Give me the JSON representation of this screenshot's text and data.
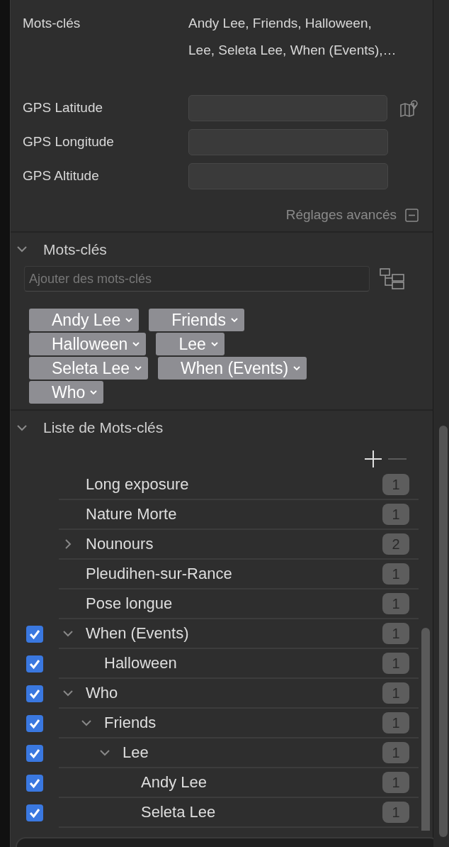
{
  "metadata": {
    "rows": [
      {
        "kind": "text",
        "label": "Mots-clés",
        "value_lines": [
          "Andy Lee, Friends, Halloween,",
          "Lee, Seleta Lee, When (Events),…"
        ]
      },
      {
        "kind": "field",
        "label": "GPS Latitude",
        "map_button": true
      },
      {
        "kind": "field",
        "label": "GPS Longitude"
      },
      {
        "kind": "field",
        "label": "GPS Altitude"
      }
    ],
    "advanced": {
      "label": "Réglages avancés",
      "expanded": true
    }
  },
  "keywords": {
    "title": "Mots-clés",
    "expanded": true,
    "placeholder": "Ajouter des mots-clés",
    "tags": [
      "Andy Lee",
      "Friends",
      "Halloween",
      "Lee",
      "Seleta Lee",
      "When (Events)",
      "Who"
    ]
  },
  "keyword_list": {
    "title": "Liste de Mots-clés",
    "expanded": true,
    "items": [
      {
        "label": "Long exposure",
        "count": "1",
        "checked": false
      },
      {
        "label": "Nature Morte",
        "count": "1",
        "checked": false
      },
      {
        "label": "Nounours",
        "count": "2",
        "checked": false,
        "expanded": false
      },
      {
        "label": "Pleudihen-sur-Rance",
        "count": "1",
        "checked": false
      },
      {
        "label": "Pose longue",
        "count": "1",
        "checked": false
      },
      {
        "label": "When (Events)",
        "count": "1",
        "checked": true,
        "expanded": true,
        "children": [
          {
            "label": "Halloween",
            "count": "1",
            "checked": true
          }
        ]
      },
      {
        "label": "Who",
        "count": "1",
        "checked": true,
        "expanded": true,
        "children": [
          {
            "label": "Friends",
            "count": "1",
            "checked": true,
            "expanded": true,
            "children": [
              {
                "label": "Lee",
                "count": "1",
                "checked": true,
                "expanded": true,
                "children": [
                  {
                    "label": "Andy Lee",
                    "count": "1",
                    "checked": true
                  },
                  {
                    "label": "Seleta Lee",
                    "count": "1",
                    "checked": true
                  }
                ]
              }
            ]
          }
        ]
      }
    ]
  }
}
